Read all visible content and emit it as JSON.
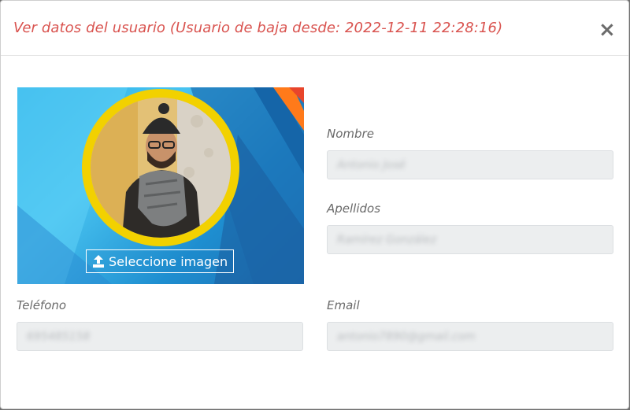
{
  "modal": {
    "title": "Ver datos del usuario (Usuario de baja desde: 2022-12-11 22:28:16)",
    "close_symbol": "×"
  },
  "photo": {
    "upload_label": "Seleccione imagen",
    "upload_icon": "upload-icon",
    "avatar_icon": "avatar-photo",
    "ring_color": "#f2d100"
  },
  "fields": {
    "nombre": {
      "label": "Nombre",
      "value": "Antonio José"
    },
    "apellidos": {
      "label": "Apellidos",
      "value": "Ramírez González"
    },
    "telefono": {
      "label": "Teléfono",
      "value": "695485158"
    },
    "email": {
      "label": "Email",
      "value": "antonio7890@gmail.com"
    }
  },
  "colors": {
    "title": "#d9534f",
    "input_bg": "#eceeef",
    "label": "#6a6a6a"
  }
}
